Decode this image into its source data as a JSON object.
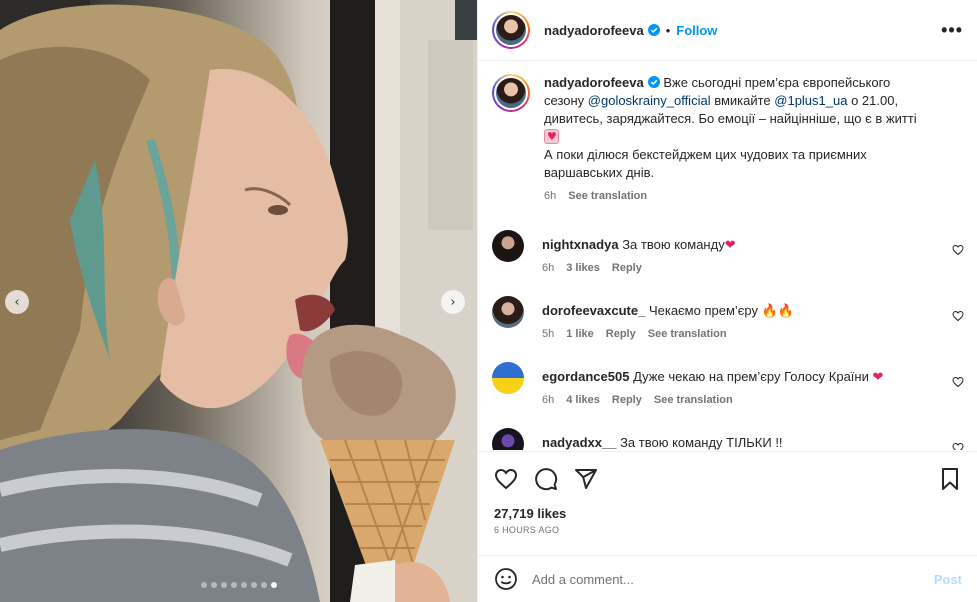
{
  "media": {
    "prev_icon": "chevron-left-icon",
    "next_icon": "chevron-right-icon",
    "slide_count": 8,
    "active_slide": 7
  },
  "header": {
    "username": "nadyadorofeeva",
    "separator": "•",
    "follow_label": "Follow",
    "more_label": "•••"
  },
  "caption": {
    "username": "nadyadorofeeva",
    "text_1": "Вже сьогодні прем’єра європейського сезону ",
    "mention_1": "@goloskrainy_official",
    "text_2": " вмикайте ",
    "mention_2": "@1plus1_ua",
    "text_3": " о 21.00, дивитесь, заряджайтеся. Бо емоції – найцінніше, що є в житті ",
    "text_4": "А поки ділюся бекстейджем цих чудових та приємних варшавських днів.",
    "time": "6h",
    "see_translation": "See translation"
  },
  "comments": [
    {
      "username": "nightxnadya",
      "text": "За твою команду",
      "emoji": "❤",
      "time": "6h",
      "likes": "3 likes",
      "reply": "Reply",
      "see_translation": ""
    },
    {
      "username": "dorofeevaxcute_",
      "text": "Чекаємо прем’єру",
      "emoji": "🔥🔥",
      "time": "5h",
      "likes": "1 like",
      "reply": "Reply",
      "see_translation": "See translation"
    },
    {
      "username": "egordance505",
      "text": "Дуже чекаю на прем’єру Голосу Країни",
      "emoji": "❤",
      "time": "6h",
      "likes": "4 likes",
      "reply": "Reply",
      "see_translation": "See translation"
    },
    {
      "username": "nadyadxx__",
      "text": "За твою команду ТІЛЬКИ !!",
      "emoji": "",
      "time": "",
      "likes": "",
      "reply": "",
      "see_translation": ""
    }
  ],
  "actions": {
    "likes": "27,719 likes",
    "time_ago": "6 HOURS AGO"
  },
  "add_comment": {
    "placeholder": "Add a comment...",
    "post_label": "Post"
  },
  "colors": {
    "accent": "#0095f6",
    "mention": "#00376b",
    "muted": "#737373",
    "heart": "#ff3040"
  }
}
